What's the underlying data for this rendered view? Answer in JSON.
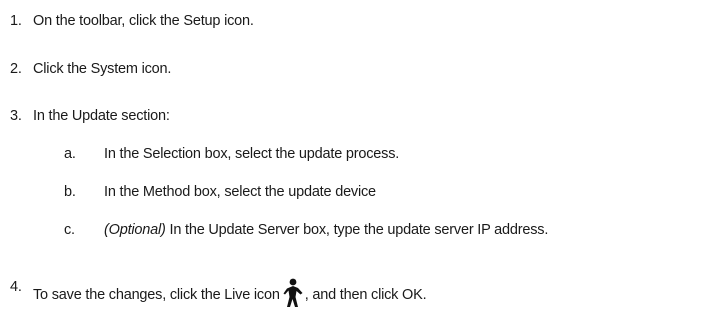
{
  "steps": [
    {
      "number": "1.",
      "text": "On the toolbar, click the Setup icon."
    },
    {
      "number": "2.",
      "text": "Click the System icon."
    },
    {
      "number": "3.",
      "text": "In the Update section:"
    },
    {
      "number": "4.",
      "text_before": "To save the changes, click the Live icon",
      "text_after": ", and then click OK."
    }
  ],
  "substeps": [
    {
      "letter": "a.",
      "text": "In the Selection box, select the update process."
    },
    {
      "letter": "b.",
      "text": "In the Method box, select the update device"
    },
    {
      "letter": "c.",
      "optional": "(Optional)",
      "text": " In the Update Server box, type the update server IP address."
    }
  ],
  "icons": {
    "live": "person-walking-icon"
  }
}
